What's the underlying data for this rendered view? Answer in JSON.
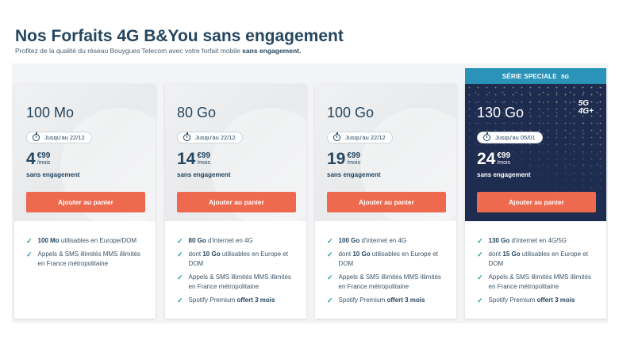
{
  "header": {
    "title": "Nos Forfaits 4G B&You sans engagement",
    "subtitle_prefix": "Profitez de la qualité du réseau Bouygues Telecom avec votre forfait mobile ",
    "subtitle_bold": "sans engagement."
  },
  "special_banner": {
    "label": "SÉRIE SPECIALE",
    "tag": "5G"
  },
  "cards": [
    {
      "data": "100 Mo",
      "promo": "Jusqu'au 22/12",
      "price_int": "4",
      "price_cents": "€99",
      "price_unit": "/mois",
      "commitment": "sans engagement",
      "button": "Ajouter au panier",
      "features": [
        {
          "bold": "100 Mo",
          "text": " utilisables en Europe/DOM",
          "bold_end": ""
        },
        {
          "bold": "",
          "text": "Appels & SMS illimités MMS illimités en France métropolitaine",
          "bold_end": ""
        }
      ]
    },
    {
      "data": "80 Go",
      "promo": "Jusqu'au 22/12",
      "price_int": "14",
      "price_cents": "€99",
      "price_unit": "/mois",
      "commitment": "sans engagement",
      "button": "Ajouter au panier",
      "features": [
        {
          "bold": "80 Go",
          "text": " d'internet en 4G",
          "bold_end": ""
        },
        {
          "bold": "",
          "text": "dont ",
          "bold_mid": "10 Go",
          "text_after": " utilisables en Europe et DOM"
        },
        {
          "bold": "",
          "text": "Appels & SMS illimités MMS illimités en France métropolitaine",
          "bold_end": ""
        },
        {
          "bold": "",
          "text": "Spotify Premium ",
          "bold_end": "offert 3 mois"
        }
      ]
    },
    {
      "data": "100 Go",
      "promo": "Jusqu'au 22/12",
      "price_int": "19",
      "price_cents": "€99",
      "price_unit": "/mois",
      "commitment": "sans engagement",
      "button": "Ajouter au panier",
      "features": [
        {
          "bold": "100 Go",
          "text": " d'internet en 4G",
          "bold_end": ""
        },
        {
          "bold": "",
          "text": "dont ",
          "bold_mid": "10 Go",
          "text_after": " utilisables en Europe et DOM"
        },
        {
          "bold": "",
          "text": "Appels & SMS illimités MMS illimités en France métropolitaine",
          "bold_end": ""
        },
        {
          "bold": "",
          "text": "Spotify Premium ",
          "bold_end": "offert 3 mois"
        }
      ]
    },
    {
      "data": "130 Go",
      "network_badge": [
        "5G",
        "4G+"
      ],
      "promo": "Jusqu'au 05/01",
      "price_int": "24",
      "price_cents": "€99",
      "price_unit": "/mois",
      "commitment": "sans engagement",
      "button": "Ajouter au panier",
      "features": [
        {
          "bold": "130 Go",
          "text": " d'internet en 4G/5G",
          "bold_end": ""
        },
        {
          "bold": "",
          "text": "dont ",
          "bold_mid": "15 Go",
          "text_after": " utilisables en Europe et DOM"
        },
        {
          "bold": "",
          "text": "Appels & SMS illimités MMS illimités en France métropolitaine",
          "bold_end": ""
        },
        {
          "bold": "",
          "text": "Spotify Premium ",
          "bold_end": "offert 3 mois"
        }
      ]
    }
  ],
  "colors": {
    "navy": "#25465f",
    "button": "#ee6a4e",
    "banner": "#2a93b9",
    "dark_card": "#1d2c4f",
    "check": "#2a9aa6"
  },
  "icons": {
    "promo": "stopwatch-icon",
    "feature": "check-icon"
  }
}
